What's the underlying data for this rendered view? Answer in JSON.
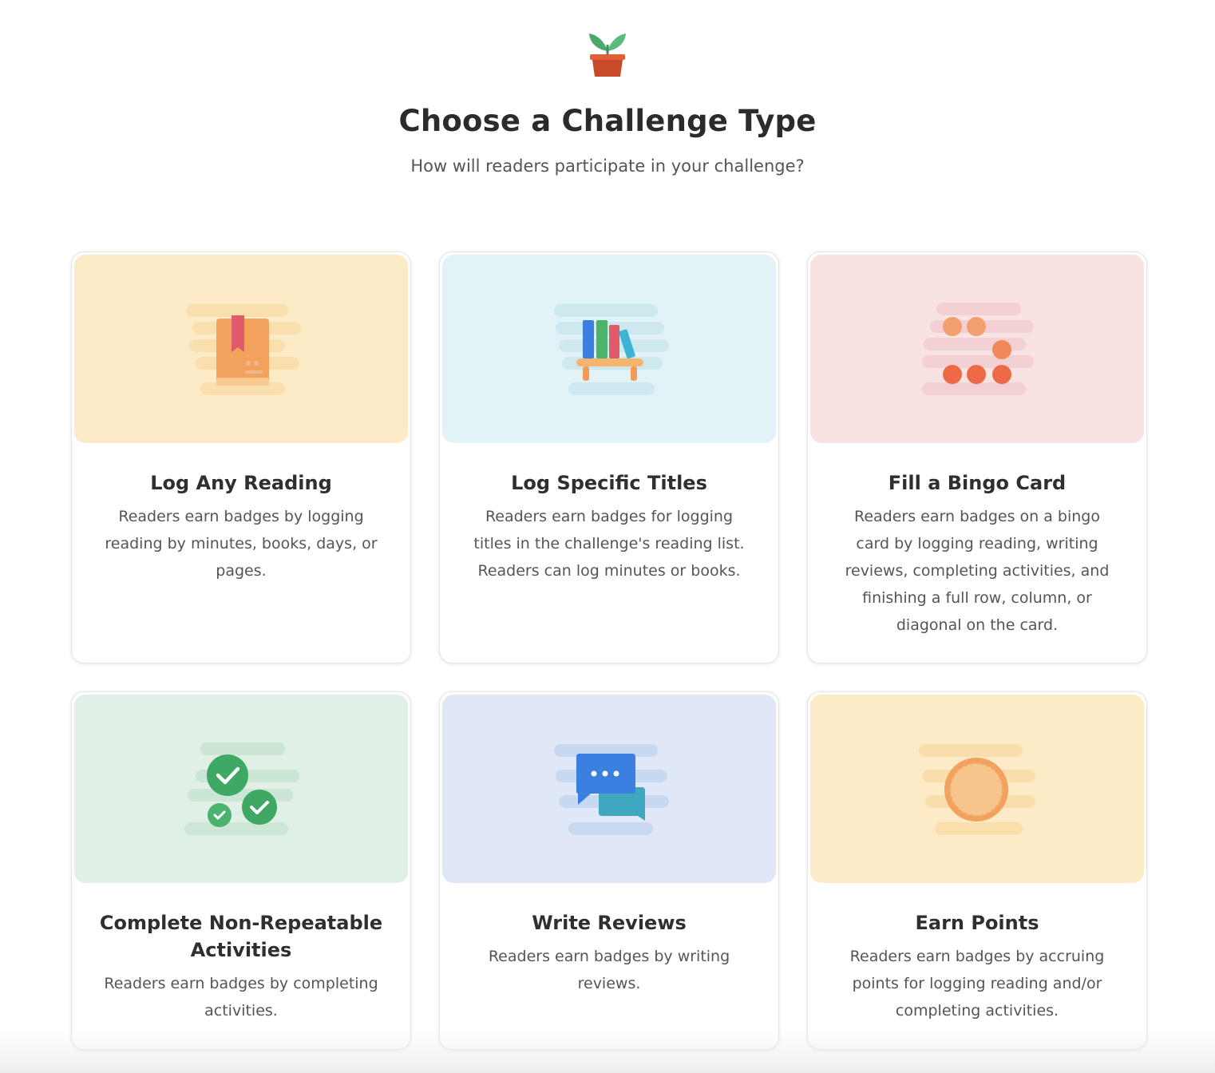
{
  "header": {
    "logo_icon": "potted-plant-icon",
    "title": "Choose a Challenge Type",
    "subtitle": "How will readers participate in your challenge?"
  },
  "cards": [
    {
      "title": "Log Any Reading",
      "description": "Readers earn badges by logging reading by minutes, books, days, or pages.",
      "icon": "book-bookmark-icon",
      "art_background": "#fdebc8"
    },
    {
      "title": "Log Specific Titles",
      "description": "Readers earn badges for logging titles in the challenge's reading list. Readers can log minutes or books.",
      "icon": "bookshelf-icon",
      "art_background": "#e2f3f7"
    },
    {
      "title": "Fill a Bingo Card",
      "description": "Readers earn badges on a bingo card by logging reading, writing reviews, completing activities, and finishing a full row, column, or diagonal on the card.",
      "icon": "bingo-dots-icon",
      "art_background": "#f9e2e2"
    },
    {
      "title": "Complete Non-Repeatable Activities",
      "description": "Readers earn badges by completing activities.",
      "icon": "check-circles-icon",
      "art_background": "#e0f0e6"
    },
    {
      "title": "Write Reviews",
      "description": "Readers earn badges by writing reviews.",
      "icon": "chat-bubbles-icon",
      "art_background": "#e0e8f7"
    },
    {
      "title": "Earn Points",
      "description": "Readers earn badges by accruing points for logging reading and/or completing activities.",
      "icon": "points-coin-icon",
      "art_background": "#fdebc8"
    }
  ]
}
